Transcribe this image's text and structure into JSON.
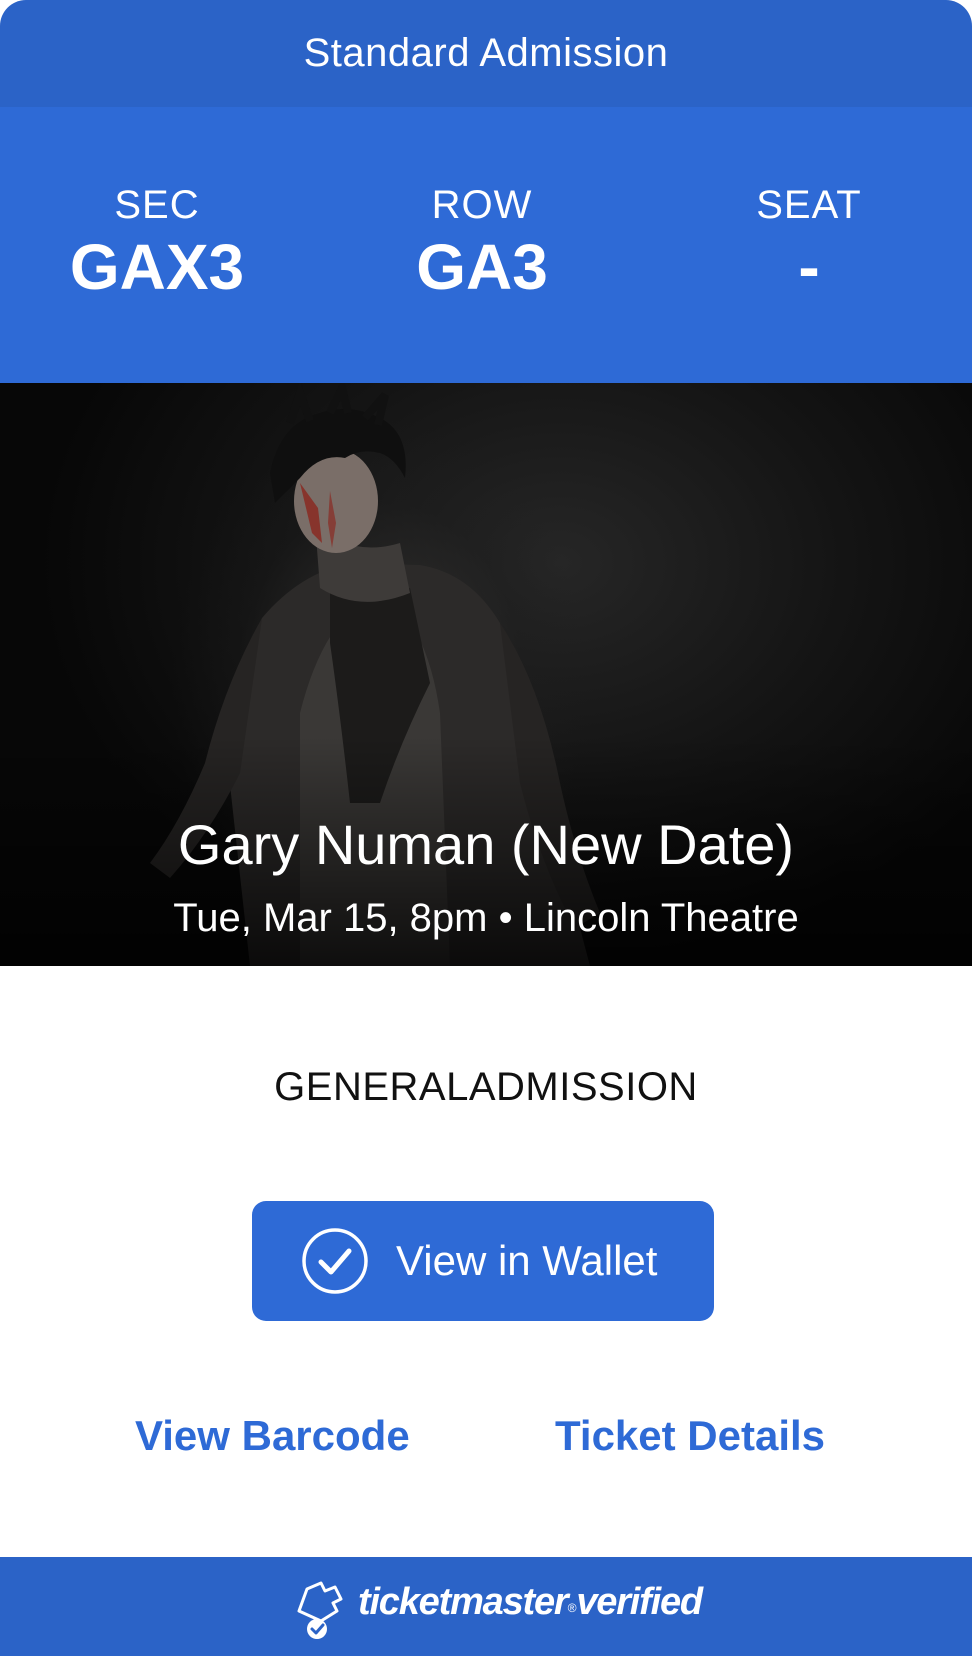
{
  "header": {
    "title": "Standard Admission"
  },
  "seat_info": {
    "section": {
      "label": "SEC",
      "value": "GAX3"
    },
    "row": {
      "label": "ROW",
      "value": "GA3"
    },
    "seat": {
      "label": "SEAT",
      "value": "-"
    }
  },
  "event": {
    "name": "Gary Numan (New Date)",
    "meta": "Tue, Mar 15, 8pm • Lincoln Theatre"
  },
  "admission_type": "GENERALADMISSION",
  "actions": {
    "wallet_label": "View in Wallet",
    "view_barcode_label": "View Barcode",
    "ticket_details_label": "Ticket Details"
  },
  "footer": {
    "brand_main": "ticketmaster",
    "brand_reg": "®",
    "brand_suffix": "verified"
  },
  "colors": {
    "header_blue": "#2b63c7",
    "brand_blue": "#2e6ad6",
    "link_blue": "#2e6ad6",
    "text_dark": "#111111"
  },
  "icons": {
    "wallet": "check-circle-icon",
    "footer": "ticket-check-icon"
  }
}
